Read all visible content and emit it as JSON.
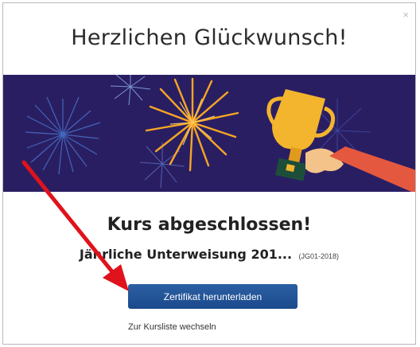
{
  "dialog": {
    "close_label": "×",
    "title": "Herzlichen Glückwunsch!",
    "subtitle": "Kurs abgeschlossen!",
    "course_name": "Jährliche Unterweisung 201...",
    "course_code": "(JG01-2018)",
    "download_button_label": "Zertifikat herunterladen",
    "course_list_link": "Zur Kursliste wechseln"
  },
  "colors": {
    "banner_bg": "#2a1e63",
    "button_bg": "#1f4f94",
    "arrow": "#e0121b",
    "trophy": "#f3b52d"
  },
  "icons": {
    "banner": "fireworks-trophy-illustration",
    "annotation": "red-arrow-annotation"
  }
}
